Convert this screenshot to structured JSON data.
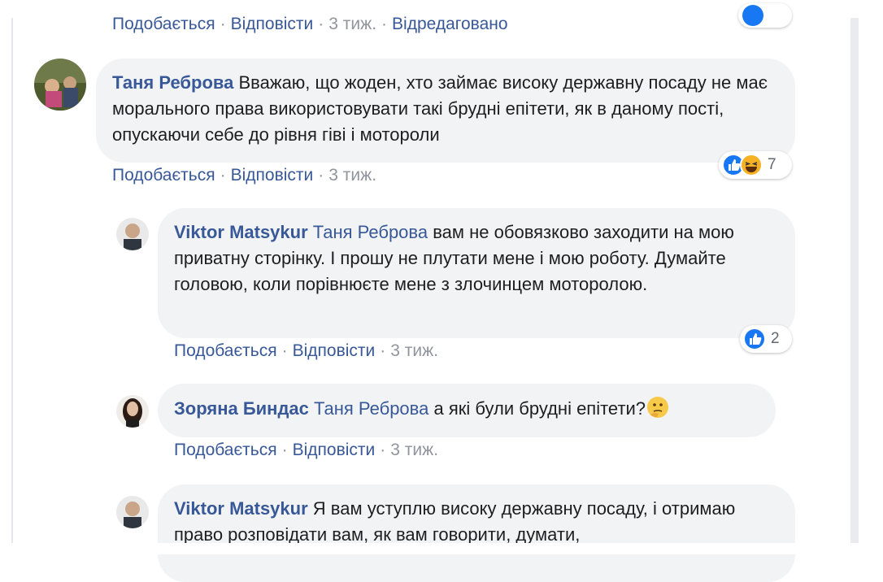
{
  "top": {
    "like": "Подобається",
    "reply": "Відповісти",
    "time": "3 тиж.",
    "edited": "Відредаговано"
  },
  "comments": [
    {
      "author": "Таня Реброва",
      "text": "Вважаю, що жоден, хто займає високу державну посаду не має морального права використовувати такі брудні епітети, як в даному пості, опускаючи себе до рівня гіві і моторолИ",
      "reaction_count": "7",
      "reactions": [
        "like-icon",
        "haha-icon"
      ],
      "like": "Подобається",
      "reply": "Відповісти",
      "time": "3 тиж."
    },
    {
      "author": "Viktor Matsykur",
      "mention": "Таня Реброва",
      "text": "вам не обовязково заходити на мою приватну сторінку. І прошу не плутати мене і мою роботу. Думайте головою, коли порівнюєте мене з злочинцем моторолою.",
      "reaction_count": "2",
      "reactions": [
        "like-icon"
      ],
      "like": "Подобається",
      "reply": "Відповісти",
      "time": "3 тиж."
    },
    {
      "author": "Зоряна Биндас",
      "mention": "Таня Реброва",
      "text": "а які були брудні епітети?",
      "emoji": "thinking-face-icon",
      "like": "Подобається",
      "reply": "Відповісти",
      "time": "3 тиж."
    },
    {
      "author": "Viktor Matsykur",
      "text": "Я вам уступлю високу державну посаду, і отримаю право розповідати вам, як вам говорити, думати,"
    }
  ],
  "separator": "·",
  "colors": {
    "link": "#385898",
    "meta": "#90949c",
    "bubble": "#f2f3f5",
    "like_blue": "#1877f2",
    "haha_yellow": "#f7b125"
  }
}
